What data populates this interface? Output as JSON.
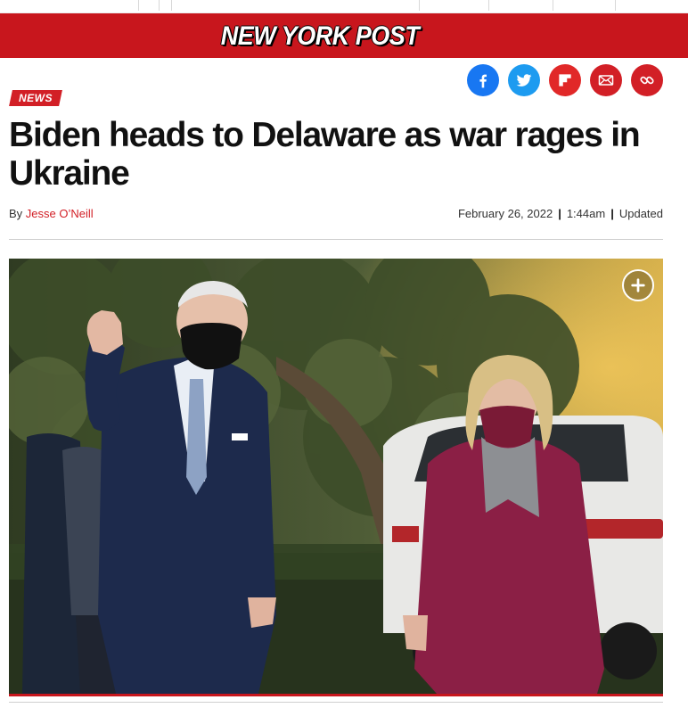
{
  "masthead": {
    "logo_text": "NEW YORK POST"
  },
  "share": {
    "facebook_icon": "facebook-icon",
    "twitter_icon": "twitter-icon",
    "flipboard_icon": "flipboard-icon",
    "email_icon": "email-icon",
    "link_icon": "link-icon"
  },
  "article": {
    "section": "NEWS",
    "headline": "Biden heads to Delaware as war rages in Ukraine",
    "byline_prefix": "By",
    "author": "Jesse O’Neill",
    "date": "February 26, 2022",
    "time": "1:44am",
    "updated": "Updated"
  },
  "photo": {
    "expand_icon": "plus-icon"
  },
  "colors": {
    "brand_red": "#c8161d",
    "facebook": "#1877f2",
    "twitter": "#1d9bf0",
    "accent_red": "#d21f26"
  }
}
